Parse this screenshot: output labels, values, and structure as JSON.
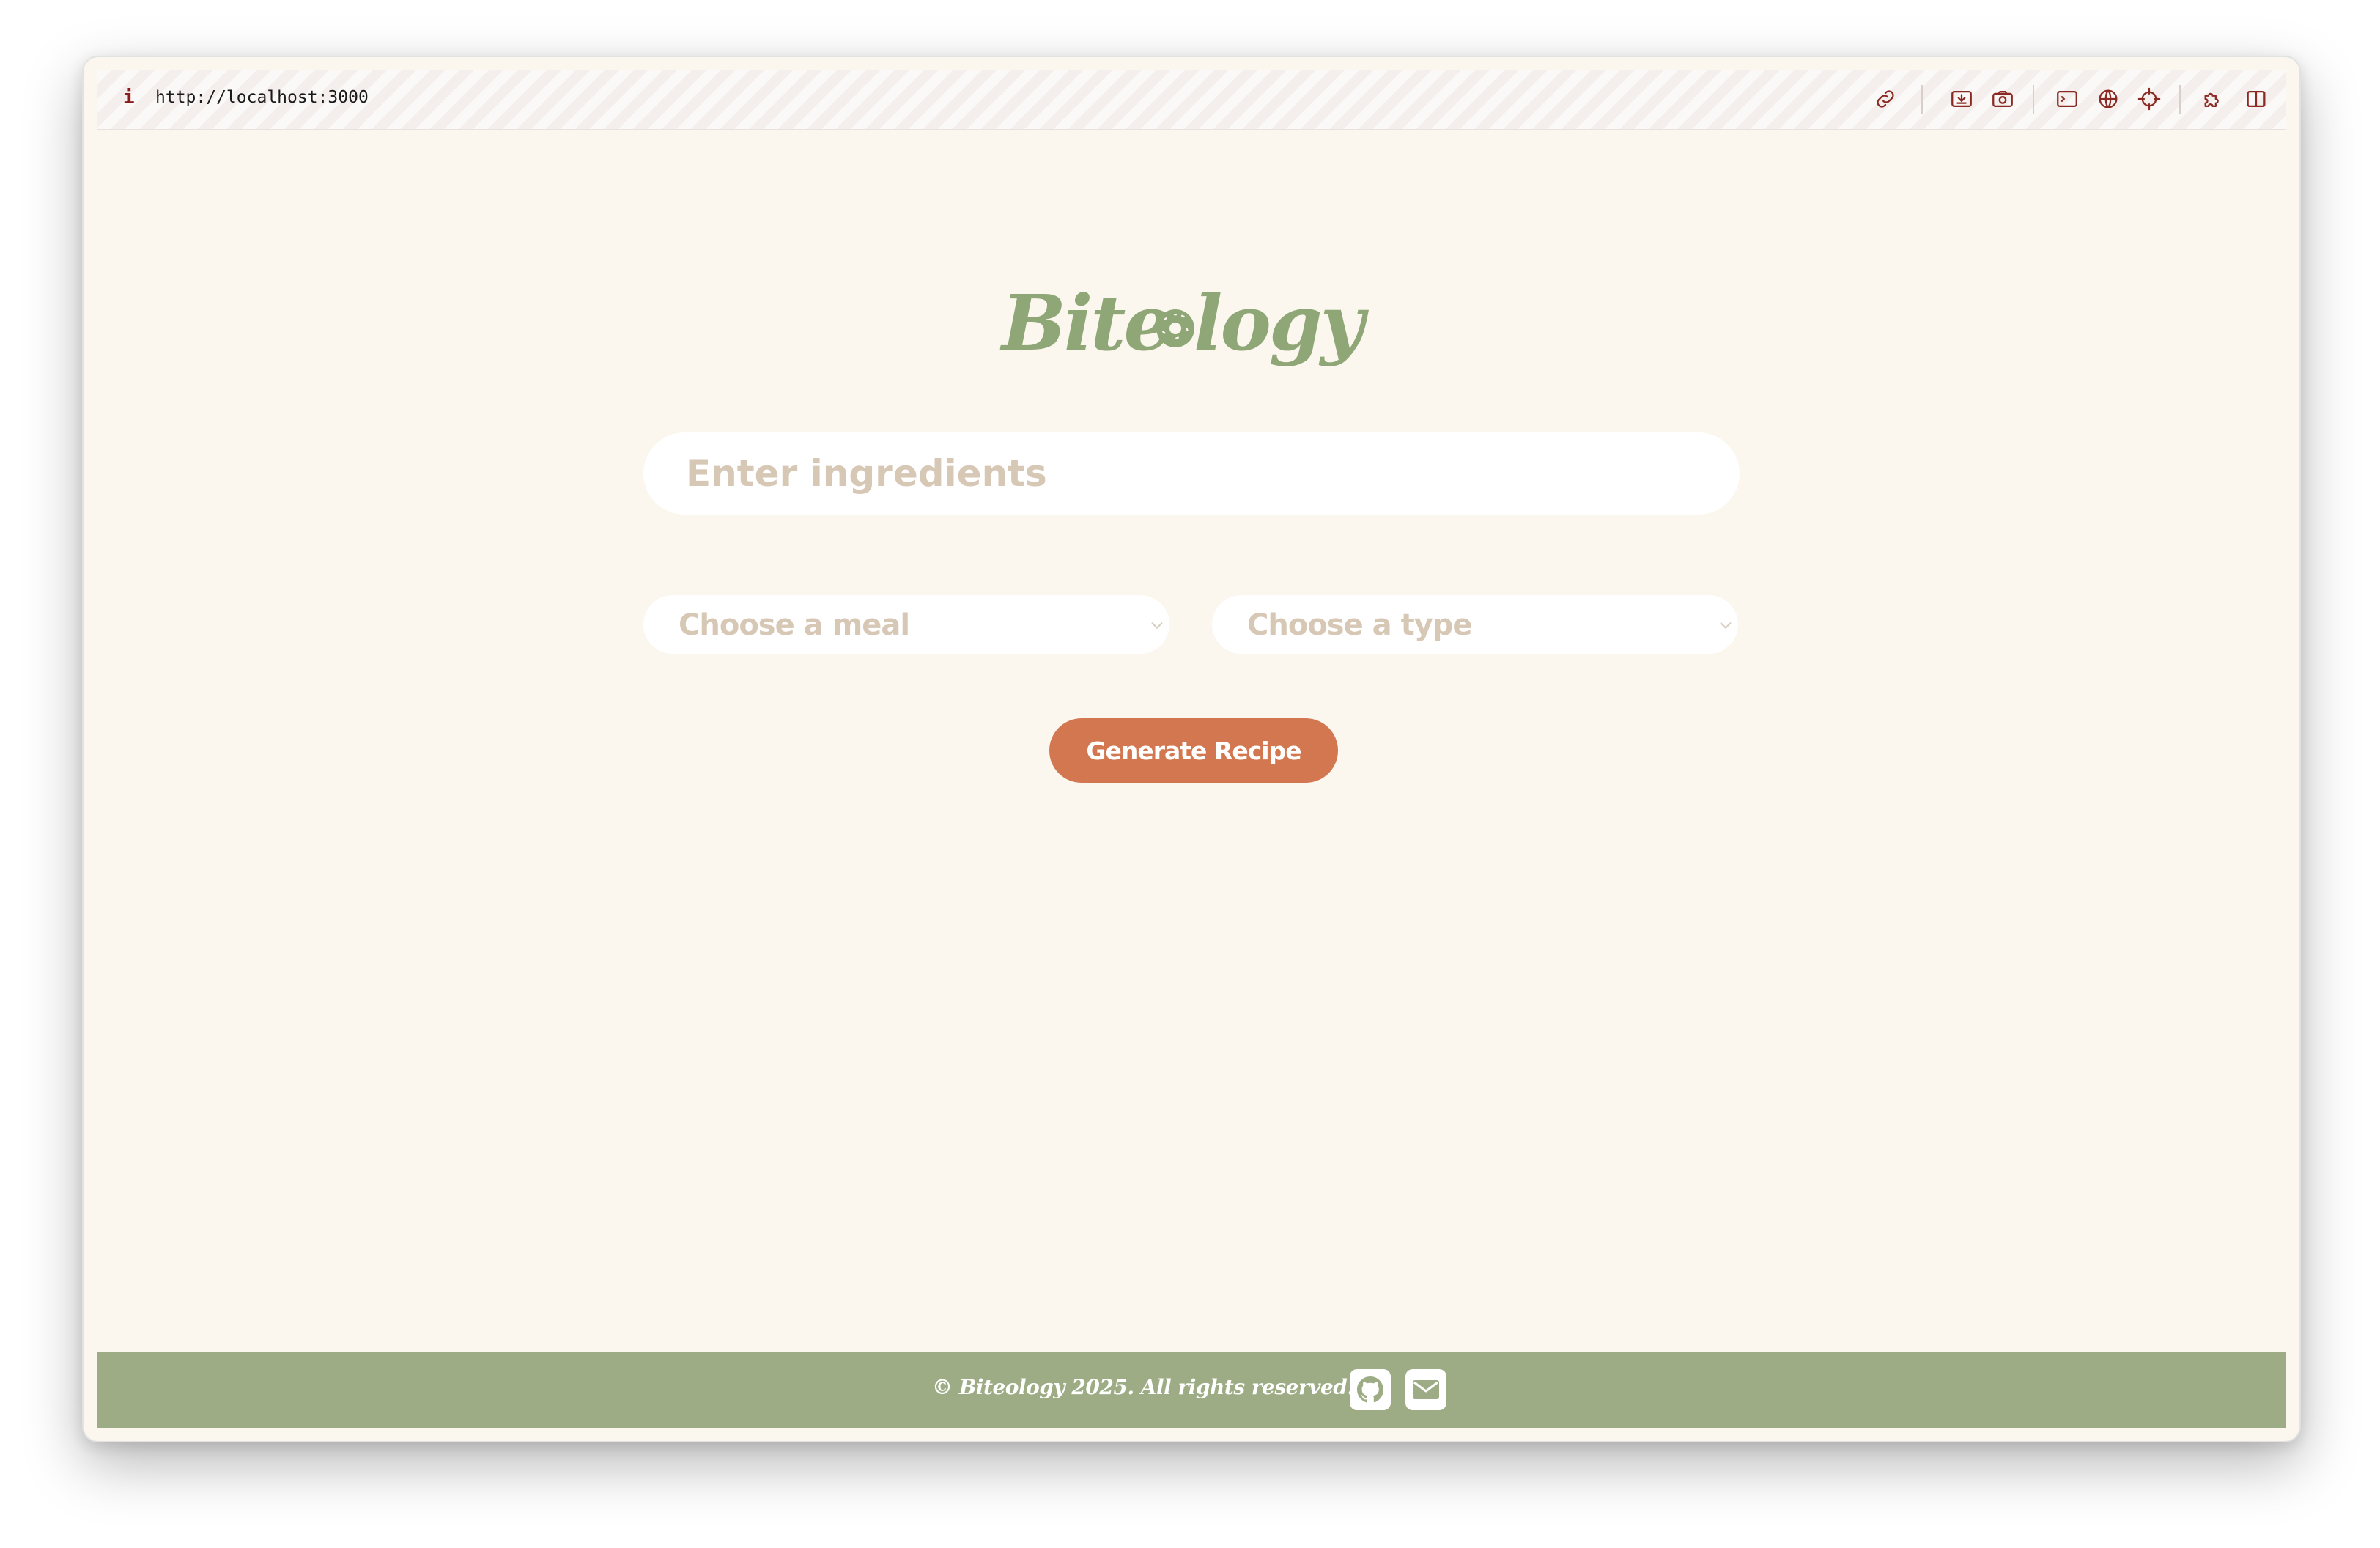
{
  "browser": {
    "info_glyph": "i",
    "url": "http://localhost:3000",
    "toolbar_icons": [
      "link-icon",
      "download-icon",
      "camera-icon",
      "terminal-icon",
      "globe-icon",
      "crosshair-icon",
      "puzzle-icon",
      "split-view-icon"
    ]
  },
  "app": {
    "logo_text_left": "Bite",
    "logo_text_right": "logy",
    "logo_icon": "donut-icon",
    "ingredients_placeholder": "Enter ingredients",
    "meal_select": {
      "placeholder": "Choose a meal"
    },
    "type_select": {
      "placeholder": "Choose a type"
    },
    "generate_label": "Generate Recipe"
  },
  "footer": {
    "copyright": "© Biteology 2025. All rights reserved.",
    "icons": [
      "github-icon",
      "mail-icon"
    ]
  },
  "colors": {
    "background": "#fbf7ee",
    "brand_green": "#8fa676",
    "footer_green": "#9dac85",
    "button_orange": "#d2774f",
    "placeholder_beige": "#d7c7b5"
  }
}
